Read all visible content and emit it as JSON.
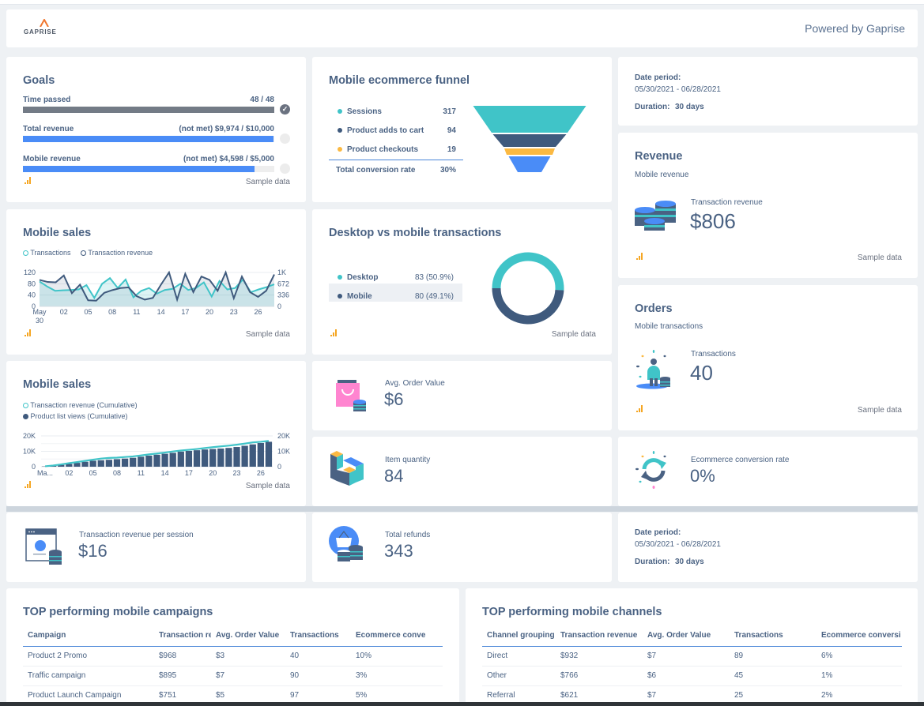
{
  "header": {
    "logo_text": "GAPRISE",
    "powered_by": "Powered by Gaprise"
  },
  "colors": {
    "teal": "#40c4c8",
    "navy": "#3f5a7d",
    "blue": "#4a8cf7",
    "amber": "#fbb942",
    "gray_bar": "#737b86",
    "text": "#4a6283"
  },
  "sample_data_label": "Sample data",
  "goals": {
    "title": "Goals",
    "items": [
      {
        "label": "Time passed",
        "value": "48 / 48",
        "progress": 1.0,
        "met": true
      },
      {
        "label": "Total revenue",
        "value": "(not met) $9,974 / $10,000",
        "progress": 0.997,
        "met": false
      },
      {
        "label": "Mobile revenue",
        "value": "(not met) $4,598 / $5,000",
        "progress": 0.92,
        "met": false
      }
    ]
  },
  "funnel": {
    "title": "Mobile ecommerce funnel",
    "stages": [
      {
        "label": "Sessions",
        "value": "317",
        "color": "#40c4c8"
      },
      {
        "label": "Product adds to cart",
        "value": "94",
        "color": "#3f5a7d"
      },
      {
        "label": "Product checkouts",
        "value": "19",
        "color": "#fbb942"
      }
    ],
    "total_label": "Total conversion rate",
    "total_value": "30%"
  },
  "date_card_top": {
    "period_label": "Date period:",
    "period_value": "05/30/2021 - 06/28/2021",
    "duration_label": "Duration:",
    "duration_value": "30 days"
  },
  "revenue": {
    "title": "Revenue",
    "subtitle": "Mobile revenue",
    "kpi_label": "Transaction revenue",
    "kpi_value": "$806"
  },
  "orders": {
    "title": "Orders",
    "subtitle": "Mobile transactions",
    "kpi_label": "Transactions",
    "kpi_value": "40"
  },
  "device_split": {
    "title": "Desktop vs mobile transactions",
    "rows": [
      {
        "label": "Desktop",
        "value": "83 (50.9%)",
        "color": "#40c4c8"
      },
      {
        "label": "Mobile",
        "value": "80 (49.1%)",
        "color": "#3f5a7d"
      }
    ]
  },
  "kpis": {
    "aov": {
      "label": "Avg. Order Value",
      "value": "$6"
    },
    "items": {
      "label": "Item quantity",
      "value": "84"
    },
    "conv": {
      "label": "Ecommerce conversion rate",
      "value": "0%"
    },
    "rps": {
      "label": "Transaction revenue per session",
      "value": "$16"
    },
    "refunds": {
      "label": "Total refunds",
      "value": "343"
    }
  },
  "date_card_bottom": {
    "period_label": "Date period:",
    "period_value": "05/30/2021 - 06/28/2021",
    "duration_label": "Duration:",
    "duration_value": "30 days"
  },
  "campaigns": {
    "title": "TOP performing mobile campaigns",
    "columns": [
      "Campaign",
      "Transaction rev",
      "Avg. Order Value",
      "Transactions",
      "Ecommerce conve"
    ],
    "rows": [
      [
        "Product 2 Promo",
        "$968",
        "$3",
        "40",
        "10%"
      ],
      [
        "Traffic campaign",
        "$895",
        "$7",
        "90",
        "3%"
      ],
      [
        "Product Launch Campaign",
        "$751",
        "$5",
        "97",
        "5%"
      ]
    ]
  },
  "channels": {
    "title": "TOP performing mobile channels",
    "columns": [
      "Channel grouping",
      "Transaction revenue",
      "Avg. Order Value",
      "Transactions",
      "Ecommerce conversi"
    ],
    "rows": [
      [
        "Direct",
        "$932",
        "$7",
        "89",
        "6%"
      ],
      [
        "Other",
        "$766",
        "$6",
        "45",
        "1%"
      ],
      [
        "Referral",
        "$621",
        "$7",
        "25",
        "2%"
      ]
    ]
  },
  "chart_data": [
    {
      "type": "pie",
      "title": "Desktop vs mobile transactions",
      "categories": [
        "Desktop",
        "Mobile"
      ],
      "values": [
        83,
        80
      ],
      "donut": true
    },
    {
      "type": "line",
      "title": "Mobile sales",
      "legend": [
        "Transactions",
        "Transaction revenue"
      ],
      "x_ticks": [
        "May 30",
        "02",
        "05",
        "08",
        "11",
        "14",
        "17",
        "20",
        "23",
        "26"
      ],
      "y_left_ticks": [
        "0",
        "40",
        "80",
        "120"
      ],
      "y_right_ticks": [
        "0",
        "336",
        "672",
        "1K"
      ],
      "ylim_left": [
        0,
        120
      ],
      "ylim_right": [
        0,
        1000
      ],
      "series": [
        {
          "name": "Transactions",
          "axis": "left",
          "values": [
            88,
            70,
            55,
            57,
            58,
            60,
            75,
            30,
            80,
            100,
            65,
            95,
            32,
            55,
            65,
            45,
            58,
            62,
            80,
            58,
            65,
            85,
            35,
            90,
            60,
            65,
            95,
            50,
            60,
            68,
            78
          ]
        },
        {
          "name": "Transaction revenue",
          "axis": "right",
          "values": [
            780,
            720,
            710,
            910,
            390,
            640,
            180,
            170,
            400,
            480,
            540,
            560,
            300,
            200,
            250,
            640,
            1000,
            200,
            960,
            420,
            880,
            780,
            460,
            1000,
            240,
            880,
            420,
            280,
            460,
            940
          ]
        }
      ],
      "grid": true
    },
    {
      "type": "bar",
      "title": "Mobile sales",
      "legend": [
        "Transaction revenue (Cumulative)",
        "Product list views (Cumulative)"
      ],
      "x_ticks": [
        "Ma...",
        "02",
        "05",
        "08",
        "11",
        "14",
        "17",
        "20",
        "23",
        "26"
      ],
      "y_left_ticks": [
        "0",
        "10K",
        "20K"
      ],
      "y_right_ticks": [
        "0",
        "10K",
        "20K"
      ],
      "ylim": [
        0,
        20000
      ],
      "series": [
        {
          "name": "Product list views (Cumulative)",
          "kind": "bar",
          "values": [
            200,
            700,
            1200,
            1800,
            2500,
            3200,
            3900,
            4200,
            4500,
            4900,
            5300,
            5800,
            6500,
            7200,
            7800,
            8400,
            9000,
            9800,
            10300,
            10700,
            11200,
            11500,
            11800,
            12200,
            12800,
            13600,
            14500,
            15400,
            16200
          ]
        },
        {
          "name": "Transaction revenue (Cumulative)",
          "kind": "line",
          "values": [
            300,
            800,
            1500,
            2300,
            3000,
            3800,
            4600,
            5300,
            5700,
            5900,
            6300,
            6700,
            7300,
            8000,
            8600,
            9200,
            9900,
            10500,
            11000,
            11500,
            12100,
            12700,
            13200,
            13700,
            14300,
            15000,
            15800,
            16200,
            16800
          ]
        }
      ],
      "grid": true
    },
    {
      "type": "bar",
      "title": "Mobile ecommerce funnel",
      "categories": [
        "Sessions",
        "Product adds to cart",
        "Product checkouts"
      ],
      "values": [
        317,
        94,
        19
      ]
    }
  ]
}
